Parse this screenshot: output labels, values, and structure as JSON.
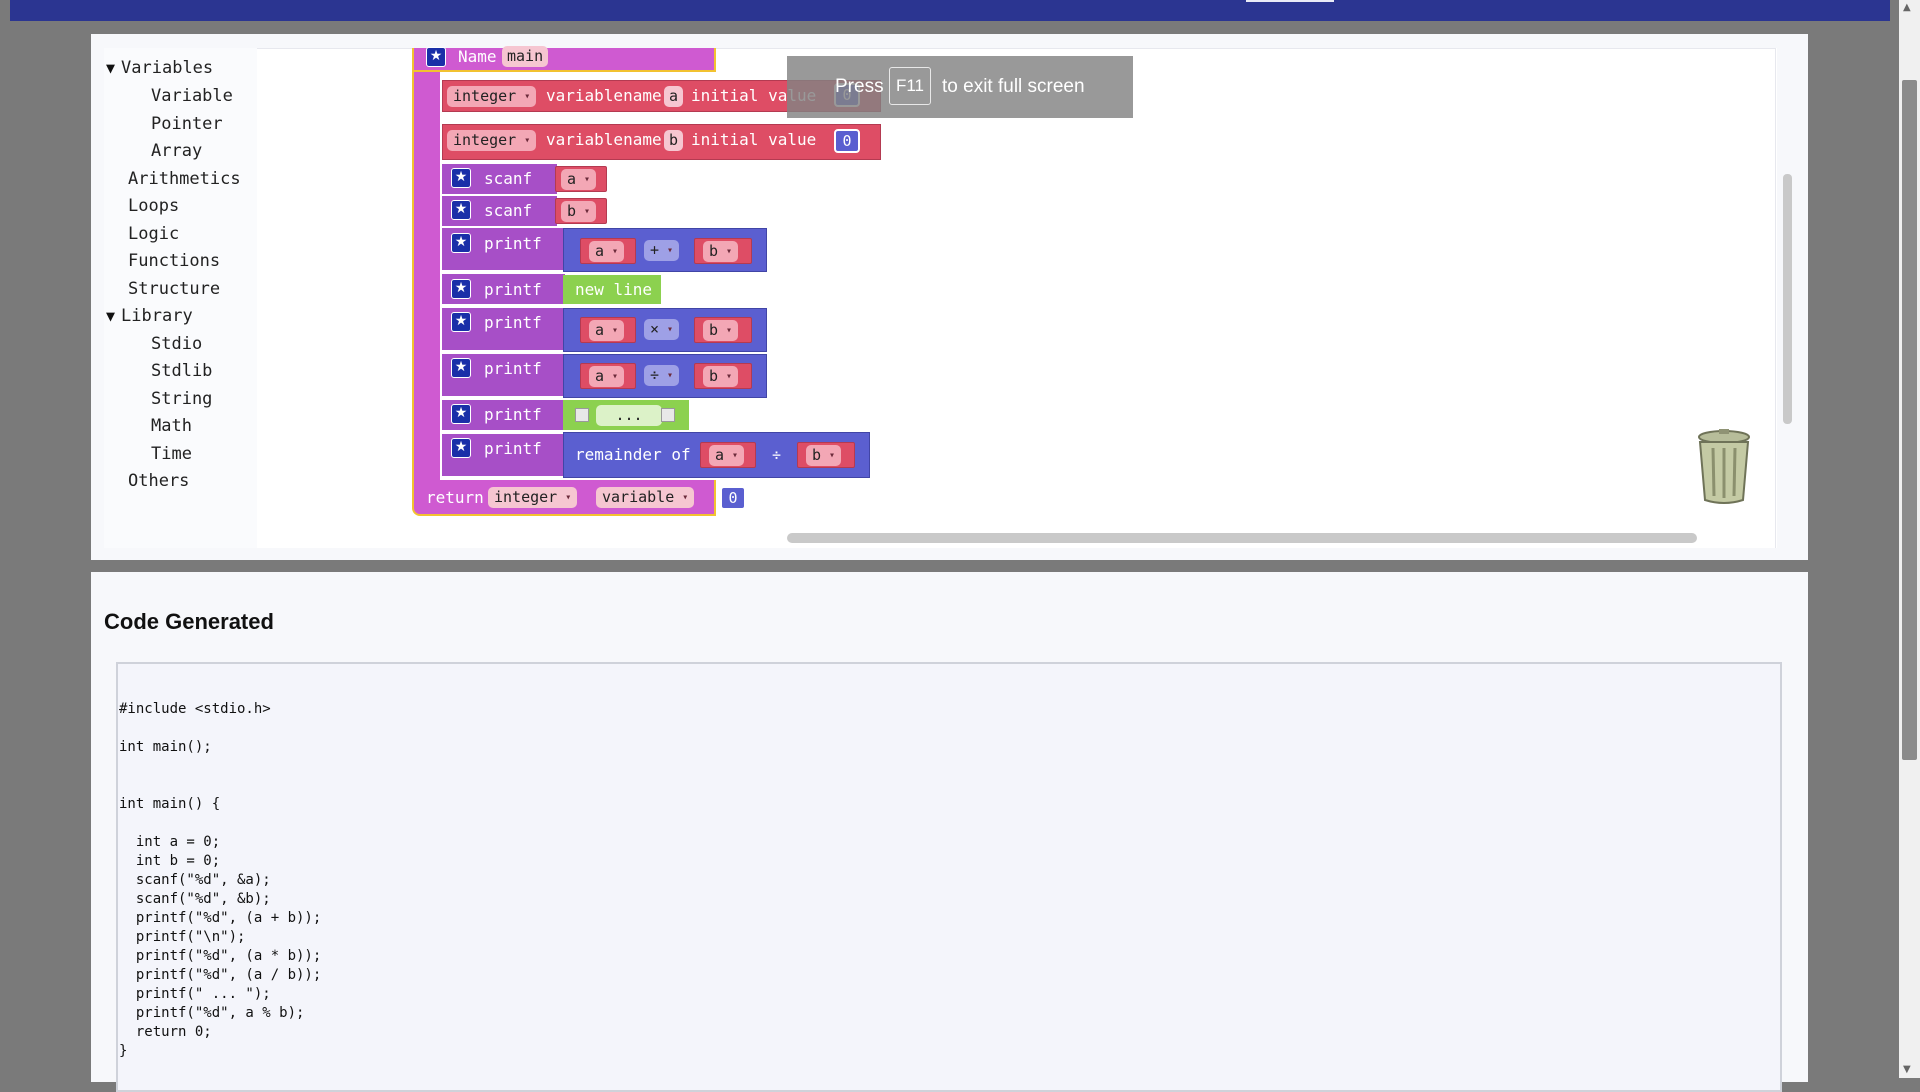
{
  "toolbox": {
    "items": [
      {
        "label": "Variables",
        "arrow": "▼"
      },
      {
        "label": "Variable"
      },
      {
        "label": "Pointer"
      },
      {
        "label": "Array"
      },
      {
        "label": "Arithmetics"
      },
      {
        "label": "Loops"
      },
      {
        "label": "Logic"
      },
      {
        "label": "Functions"
      },
      {
        "label": "Structure"
      },
      {
        "label": "Library",
        "arrow": "▼"
      },
      {
        "label": "Stdio"
      },
      {
        "label": "Stdlib"
      },
      {
        "label": "String"
      },
      {
        "label": "Math"
      },
      {
        "label": "Time"
      },
      {
        "label": "Others"
      }
    ]
  },
  "blocks": {
    "func": {
      "name_label": "Name",
      "name_value": "main"
    },
    "decl_a": {
      "type": "integer",
      "label1": "variablename",
      "var": "a",
      "label2": "initial value",
      "value": "0"
    },
    "decl_b": {
      "type": "integer",
      "label1": "variablename",
      "var": "b",
      "label2": "initial value",
      "value": "0"
    },
    "scanf_a": {
      "label": "scanf",
      "var": "a"
    },
    "scanf_b": {
      "label": "scanf",
      "var": "b"
    },
    "printf_add": {
      "label": "printf",
      "left": "a",
      "op": "+",
      "right": "b"
    },
    "printf_newline": {
      "label": "printf",
      "text": "new line"
    },
    "printf_mul": {
      "label": "printf",
      "left": "a",
      "op": "×",
      "right": "b"
    },
    "printf_div": {
      "label": "printf",
      "left": "a",
      "op": "÷",
      "right": "b"
    },
    "printf_text": {
      "label": "printf",
      "text": "..."
    },
    "printf_rem": {
      "label": "printf",
      "text": "remainder of",
      "left": "a",
      "op": "÷",
      "right": "b"
    },
    "ret": {
      "label": "return",
      "type": "integer",
      "kind": "variable",
      "value": "0"
    }
  },
  "fullscreen_toast": {
    "pre": "Press",
    "key": "F11",
    "post": "to exit full screen"
  },
  "code": {
    "title": "Code Generated",
    "text": "#include <stdio.h>\n\nint main();\n\n\nint main() {\n\n  int a = 0;\n  int b = 0;\n  scanf(\"%d\", &a);\n  scanf(\"%d\", &b);\n  printf(\"%d\", (a + b));\n  printf(\"\\n\");\n  printf(\"%d\", (a * b));\n  printf(\"%d\", (a / b));\n  printf(\" ... \");\n  printf(\"%d\", a % b);\n  return 0;\n}"
  },
  "colors": {
    "variable_block": "#de4d65",
    "function_block": "#cf5ad1",
    "statement_block": "#a74fc7",
    "math_block": "#5b5fd0",
    "text_block": "#8cd14f",
    "topbar": "#2b3591"
  }
}
